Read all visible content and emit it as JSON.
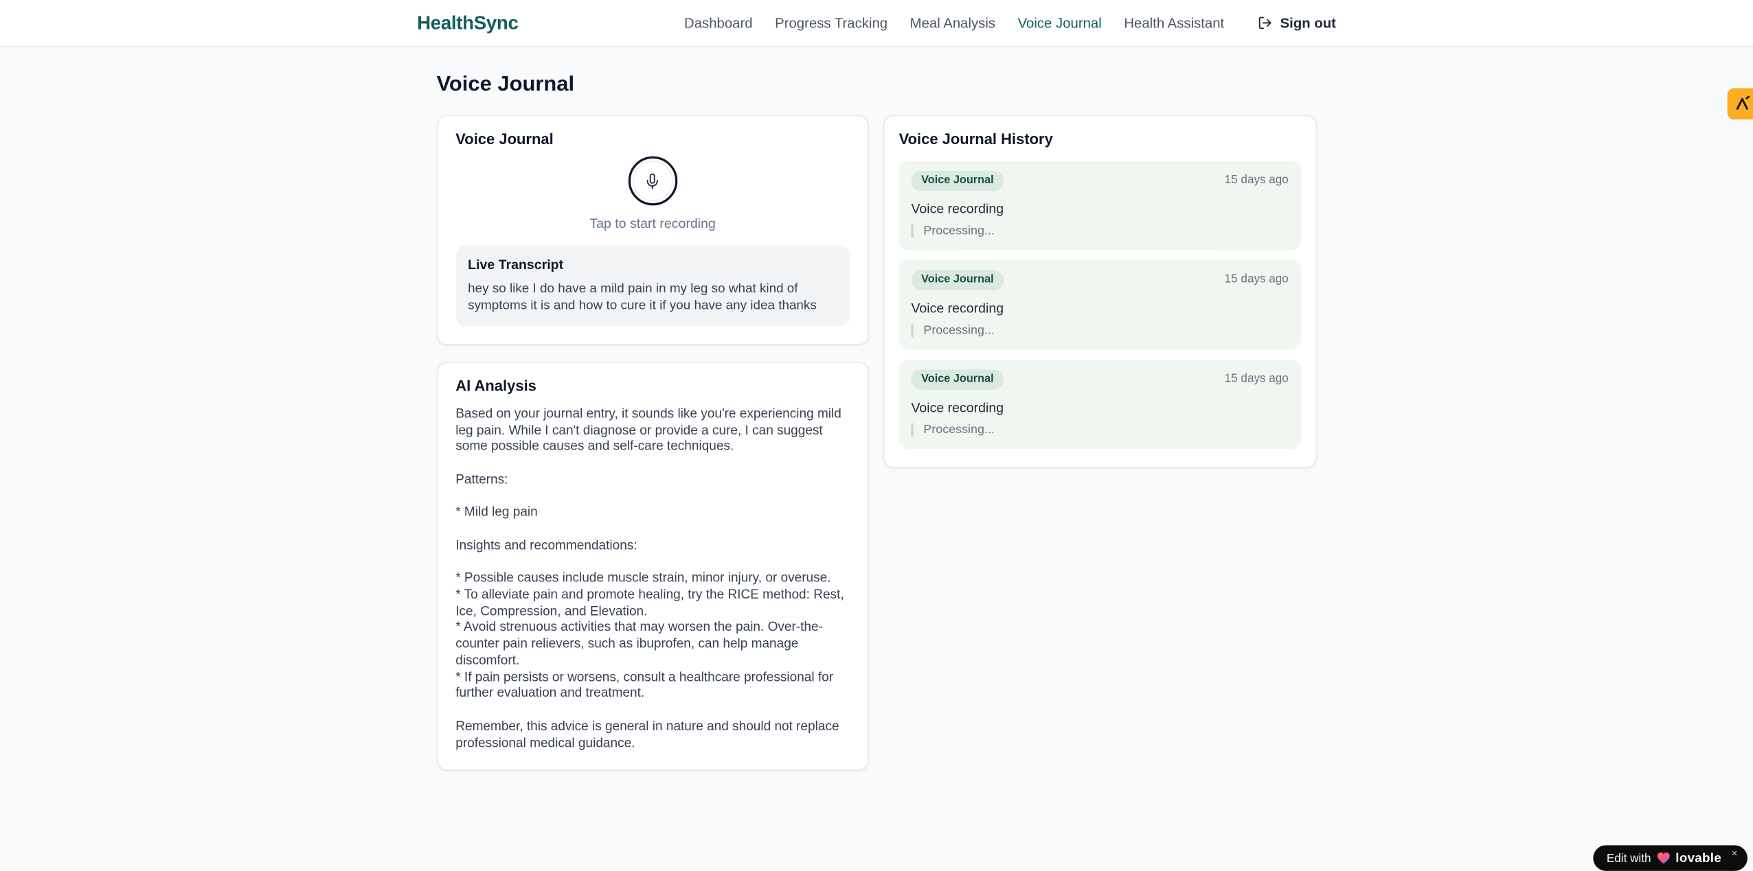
{
  "colors": {
    "accent": "#115e59",
    "page_background": "#f8fafc",
    "entry_background": "#f0f6f0",
    "badge_background": "#dbe9e1",
    "badge_text": "#15503f",
    "side_badge": "#fbad24",
    "lovable_background": "#0c0c0d"
  },
  "header": {
    "brand": "HealthSync",
    "nav": [
      {
        "label": "Dashboard",
        "active": false
      },
      {
        "label": "Progress Tracking",
        "active": false
      },
      {
        "label": "Meal Analysis",
        "active": false
      },
      {
        "label": "Voice Journal",
        "active": true
      },
      {
        "label": "Health Assistant",
        "active": false
      }
    ],
    "sign_out_label": "Sign out"
  },
  "page": {
    "title": "Voice Journal"
  },
  "recorder_card": {
    "title": "Voice Journal",
    "tap_hint": "Tap to start recording",
    "live_transcript_title": "Live Transcript",
    "live_transcript_text": "hey so like I do have a mild pain in my leg so what kind of symptoms it is and how to cure it if you have any idea thanks"
  },
  "analysis_card": {
    "title": "AI Analysis",
    "body": "Based on your journal entry, it sounds like you're experiencing mild leg pain. While I can't diagnose or provide a cure, I can suggest some possible causes and self-care techniques.\n\nPatterns:\n\n* Mild leg pain\n\nInsights and recommendations:\n\n* Possible causes include muscle strain, minor injury, or overuse.\n* To alleviate pain and promote healing, try the RICE method: Rest, Ice, Compression, and Elevation.\n* Avoid strenuous activities that may worsen the pain. Over-the-counter pain relievers, such as ibuprofen, can help manage discomfort.\n* If pain persists or worsens, consult a healthcare professional for further evaluation and treatment.\n\nRemember, this advice is general in nature and should not replace professional medical guidance."
  },
  "history_panel": {
    "title": "Voice Journal History",
    "entries": [
      {
        "badge": "Voice Journal",
        "time": "15 days ago",
        "text": "Voice recording",
        "status": "Processing..."
      },
      {
        "badge": "Voice Journal",
        "time": "15 days ago",
        "text": "Voice recording",
        "status": "Processing..."
      },
      {
        "badge": "Voice Journal",
        "time": "15 days ago",
        "text": "Voice recording",
        "status": "Processing..."
      }
    ]
  },
  "overlays": {
    "lovable_prefix": "Edit with",
    "lovable_brand": "lovable",
    "lovable_close": "×"
  }
}
